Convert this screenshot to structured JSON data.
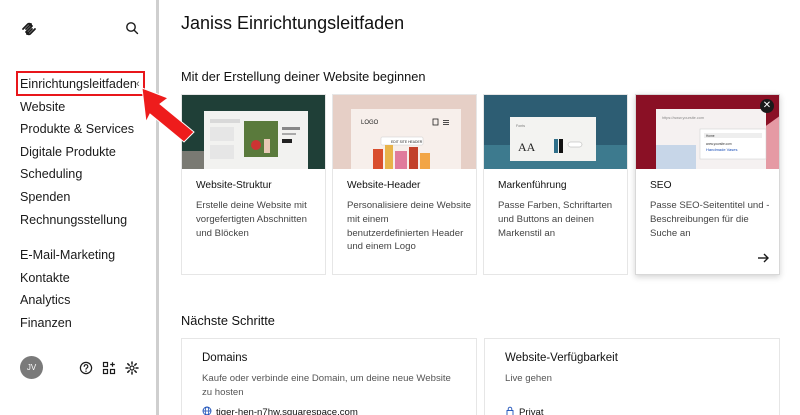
{
  "sidebar": {
    "avatar_initials": "JV",
    "items_group_1": [
      {
        "label": "Einrichtungsleitfaden",
        "active": true
      },
      {
        "label": "Website"
      },
      {
        "label": "Produkte & Services"
      },
      {
        "label": "Digitale Produkte"
      },
      {
        "label": "Scheduling"
      },
      {
        "label": "Spenden"
      },
      {
        "label": "Rechnungsstellung"
      }
    ],
    "items_group_2": [
      {
        "label": "E-Mail-Marketing"
      },
      {
        "label": "Kontakte"
      },
      {
        "label": "Analytics"
      },
      {
        "label": "Finanzen"
      }
    ]
  },
  "main": {
    "title": "Janiss Einrichtungsleitfaden",
    "section_start": "Mit der Erstellung deiner Website beginnen",
    "section_next": "Nächste Schritte",
    "cards": [
      {
        "title": "Website-Struktur",
        "desc": "Erstelle deine Website mit vorgefertigten Abschnitten und Blöcken"
      },
      {
        "title": "Website-Header",
        "desc": "Personalisiere deine Website mit einem benutzerdefinierten Header und einem Logo"
      },
      {
        "title": "Markenführung",
        "desc": "Passe Farben, Schriftarten und Buttons an deinen Markenstil an"
      },
      {
        "title": "SEO",
        "desc": "Passe SEO-Seitentitel und -Beschreibungen für die Suche an"
      }
    ],
    "card_images": {
      "header_logo_text": "LOGO",
      "header_button_text": "EDIT SITE HEADER",
      "brand_fonts_text": "Fonts",
      "brand_aa": "AA",
      "seo_url": "https://www.yoursite.com",
      "seo_small_title": "Home",
      "seo_snippet_url": "www.yoursite.com",
      "seo_snippet_title": "Handmade Vases"
    },
    "steps": [
      {
        "title": "Domains",
        "desc": "Kaufe oder verbinde eine Domain, um deine neue Website zu hosten",
        "link": "tiger-hen-n7hw.squarespace.com"
      },
      {
        "title": "Website-Verfügbarkeit",
        "desc": "Live gehen",
        "link": "Privat"
      }
    ]
  },
  "colors": {
    "highlight": "#e8161b",
    "arrow": "#ee1c1c",
    "sidebar_divider": "#cfcfcf",
    "avatar": "#7a7a7a"
  },
  "icons": [
    "squarespace-logo-icon",
    "search-icon",
    "help-icon",
    "apps-icon",
    "settings-icon",
    "close-icon",
    "arrow-right-icon",
    "globe-icon",
    "lock-icon"
  ]
}
